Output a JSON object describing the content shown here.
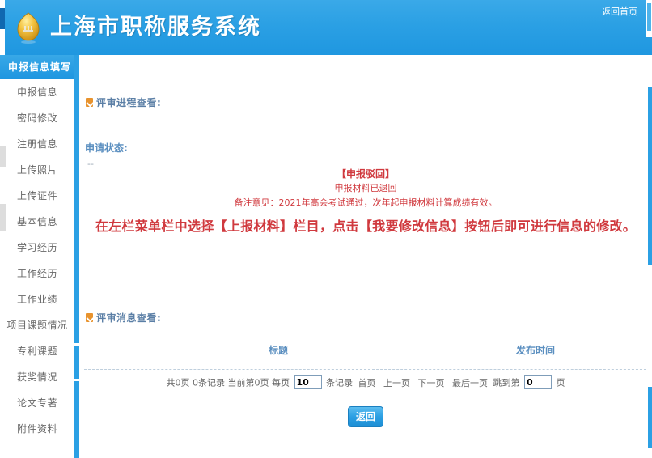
{
  "header": {
    "title": "上海市职称服务系统",
    "home_link": "返回首页",
    "logo_icon": "shield-logo-icon"
  },
  "sidebar": {
    "header_label": "申报信息填写",
    "items": [
      {
        "label": "申报信息"
      },
      {
        "label": "密码修改"
      },
      {
        "label": "注册信息"
      },
      {
        "label": "上传照片"
      },
      {
        "label": "上传证件"
      },
      {
        "label": "基本信息"
      },
      {
        "label": "学习经历"
      },
      {
        "label": "工作经历"
      },
      {
        "label": "工作业绩"
      },
      {
        "label": "项目课题情况"
      },
      {
        "label": "专利课题"
      },
      {
        "label": "获奖情况"
      },
      {
        "label": "论文专著"
      },
      {
        "label": "附件资料"
      }
    ]
  },
  "main": {
    "process_section": {
      "title": "评审进程查看:",
      "bullet_icon": "orange-arrow-icon",
      "status_label": "申请状态:",
      "status_value": "--",
      "notice_status": "【申报驳回】",
      "notice_sub": "申报材料已退回",
      "notice_remark": "备注意见：2021年高会考试通过，次年起申报材料计算成绩有效。",
      "notice_instruction": "在左栏菜单栏中选择【上报材料】栏目，点击【我要修改信息】按钮后即可进行信息的修改。"
    },
    "message_section": {
      "title": "评审消息查看:",
      "bullet_icon": "orange-arrow-icon",
      "columns": [
        "标题",
        "发布时间"
      ],
      "rows": []
    },
    "pagination": {
      "total_pages_text": "共0页",
      "total_records_text": "0条记录",
      "current_page_text": "当前第0页",
      "per_page_prefix": "每页",
      "per_page_value": "10",
      "per_page_suffix": "条记录",
      "first_page": "首页",
      "prev_page": "上一页",
      "next_page": "下一页",
      "last_page": "最后一页",
      "jump_prefix": "跳到第",
      "jump_value": "0",
      "jump_suffix": "页"
    },
    "back_button": "返回"
  },
  "colors": {
    "brand_blue": "#2ba0e4",
    "accent_orange": "#e8932e",
    "alert_red": "#d0393e",
    "label_blue": "#5b8fc0"
  }
}
